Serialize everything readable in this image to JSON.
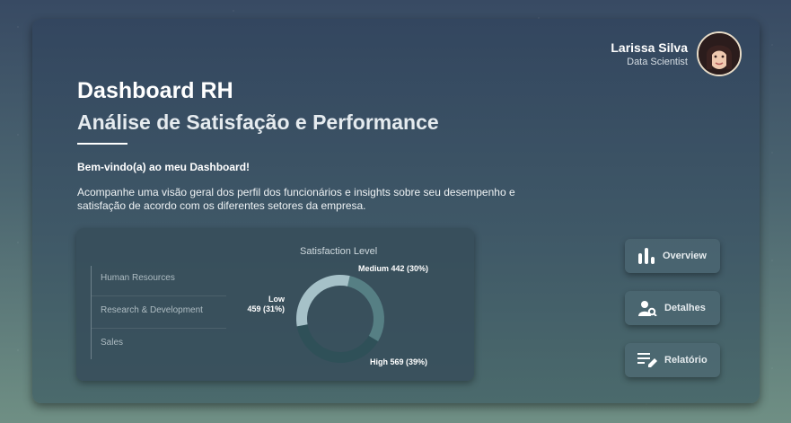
{
  "profile": {
    "name": "Larissa Silva",
    "role": "Data Scientist"
  },
  "header": {
    "title": "Dashboard RH",
    "subtitle": "Análise de Satisfação e Performance"
  },
  "intro": {
    "welcome": "Bem-vindo(a) ao meu Dashboard!",
    "description": "Acompanhe uma visão geral dos perfil dos funcionários e insights sobre seu desempenho e satisfação de acordo com os diferentes setores da empresa."
  },
  "departments": [
    "Human Resources",
    "Research & Development",
    "Sales"
  ],
  "chart_data": {
    "type": "pie",
    "title": "Satisfaction Level",
    "series": [
      {
        "name": "Medium",
        "value": 442,
        "percent": 30,
        "label_name": "Medium",
        "label_value": "442 (30%)",
        "color": "#567f84"
      },
      {
        "name": "High",
        "value": 569,
        "percent": 39,
        "label_name": "High",
        "label_value": "569 (39%)",
        "color": "#2f5058"
      },
      {
        "name": "Low",
        "value": 459,
        "percent": 31,
        "label_name": "Low",
        "label_value": "459 (31%)",
        "color": "#a6c1c8"
      }
    ]
  },
  "nav": [
    {
      "label": "Overview",
      "icon": "bar-chart-icon"
    },
    {
      "label": "Detalhes",
      "icon": "user-search-icon"
    },
    {
      "label": "Relatório",
      "icon": "report-edit-icon"
    }
  ],
  "colors": {
    "accent": "#ffffff",
    "panel": "#3f5867"
  }
}
